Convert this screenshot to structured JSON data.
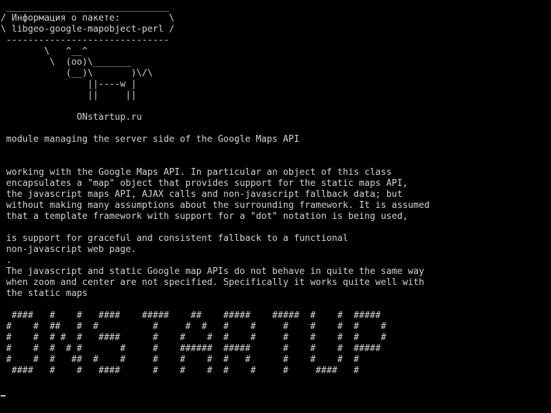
{
  "terminal": {
    "lines": [
      " ______________________________",
      "/ Информация о пакете:         \\",
      "\\ libgeo-google-mapobject-perl /",
      " ------------------------------",
      "        \\   ^__^",
      "         \\  (oo)\\_______",
      "            (__)\\       )\\/\\",
      "                ||----w |",
      "                ||     ||",
      "",
      "              ONstartup.ru",
      "",
      " module managing the server side of the Google Maps API",
      "",
      "",
      " working with the Google Maps API. In particular an object of this class",
      " encapsulates a \"map\" object that provides support for the static maps API,",
      " the javascript maps API, AJAX calls and non-javascript fallback data; but",
      " without making many assumptions about the surrounding framework. It is assumed",
      " that a template framework with support for a \"dot\" notation is being used,",
      "",
      " is support for graceful and consistent fallback to a functional",
      " non-javascript web page.",
      " .",
      " The javascript and static Google map APIs do not behave in quite the same way",
      " when zoom and center are not specified. Specifically it works quite well with",
      " the static maps",
      "",
      "  ####   #    #   ####    #####    ##    #####    #####  #    #  #####",
      " #    #  ##   #  #          #     #  #   #    #     #    #    #  #    #",
      " #    #  # #  #   ####      #    #    #  #    #     #    #    #  #    #",
      " #    #  #  # #       #     #    ######  #####      #    #    #  #####",
      " #    #  #   ##  #    #     #    #    #  #   #      #    #    #  #",
      "  ####   #    #   ####      #    #    #  #    #     #     ####   #"
    ]
  }
}
